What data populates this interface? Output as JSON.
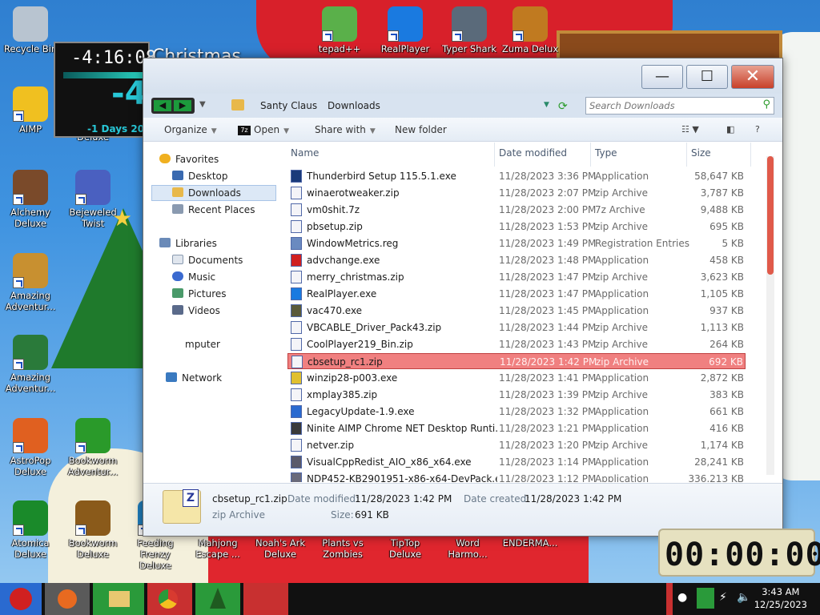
{
  "desktop": {
    "icons": [
      {
        "label": "Recycle Bin",
        "color": "#b8c4d0"
      },
      {
        "label": "AIMP",
        "color": "#f0c020"
      },
      {
        "label": "Alchemy Deluxe",
        "color": "#7a4a2a"
      },
      {
        "label": "Amazing Adventur...",
        "color": "#c89030"
      },
      {
        "label": "Amazing Adventur...",
        "color": "#2a7a3a"
      },
      {
        "label": "AstroPop Deluxe",
        "color": "#e06020"
      },
      {
        "label": "Atomica Deluxe",
        "color": "#1a8a2a"
      },
      {
        "label": "Bejeweled Twist",
        "color": "#4a60c0"
      },
      {
        "label": "Bookworm Adventur...",
        "color": "#2a9a2a"
      },
      {
        "label": "Bookworm Deluxe",
        "color": "#8a5a1a"
      },
      {
        "label": "Feeding Frenzy Deluxe",
        "color": "#2080c0"
      },
      {
        "label": "Mahjong Escape ...",
        "color": "#a04020"
      },
      {
        "label": "Noah's Ark Deluxe",
        "color": "#c08020"
      },
      {
        "label": "Plants vs Zombies",
        "color": "#4aa02a"
      },
      {
        "label": "TipTop Deluxe",
        "color": "#d04040"
      },
      {
        "label": "Word Harmo...",
        "color": "#6a4ab0"
      },
      {
        "label": "ENDERMA...",
        "color": "#303030"
      },
      {
        "label": "tepad++",
        "color": "#5ab04a"
      },
      {
        "label": "RealPlayer",
        "color": "#1a7ae0"
      },
      {
        "label": "Typer Shark",
        "color": "#5a6a7a"
      },
      {
        "label": "Zuma Delux",
        "color": "#c07a20"
      },
      {
        "label": "Deluxe",
        "color": "#000000"
      }
    ],
    "clock_widget": {
      "time": "-4:16:08",
      "big": "-4",
      "days": "-1 Days 20"
    },
    "xmas_title": "Christmas",
    "timer": "00:00:00"
  },
  "window": {
    "controls": {
      "minimize": "—",
      "maximize": "☐",
      "close": "✕"
    },
    "breadcrumb": [
      "Santy Claus",
      "Downloads"
    ],
    "search_placeholder": "Search Downloads",
    "toolbar": {
      "organize": "Organize",
      "open": "Open",
      "share": "Share with",
      "new_folder": "New folder"
    },
    "nav": {
      "favorites": "Favorites",
      "desktop": "Desktop",
      "downloads": "Downloads",
      "recent": "Recent Places",
      "libraries": "Libraries",
      "documents": "Documents",
      "music": "Music",
      "pictures": "Pictures",
      "videos": "Videos",
      "computer": "mputer",
      "network": "Network"
    },
    "columns": {
      "name": "Name",
      "date": "Date modified",
      "type": "Type",
      "size": "Size"
    },
    "files": [
      {
        "name": "Thunderbird Setup 115.5.1.exe",
        "date": "11/28/2023 3:36 PM",
        "type": "Application",
        "size": "58,647 KB",
        "icon": "#1a3a7a"
      },
      {
        "name": "winaerotweaker.zip",
        "date": "11/28/2023 2:07 PM",
        "type": "zip Archive",
        "size": "3,787 KB",
        "icon": "#f4f4f8"
      },
      {
        "name": "vm0shit.7z",
        "date": "11/28/2023 2:00 PM",
        "type": "7z Archive",
        "size": "9,488 KB",
        "icon": "#f4f4f8"
      },
      {
        "name": "pbsetup.zip",
        "date": "11/28/2023 1:53 PM",
        "type": "zip Archive",
        "size": "695 KB",
        "icon": "#f4f4f8"
      },
      {
        "name": "WindowMetrics.reg",
        "date": "11/28/2023 1:49 PM",
        "type": "Registration Entries",
        "size": "5 KB",
        "icon": "#6a8ac0"
      },
      {
        "name": "advchange.exe",
        "date": "11/28/2023 1:48 PM",
        "type": "Application",
        "size": "458 KB",
        "icon": "#d02020"
      },
      {
        "name": "merry_christmas.zip",
        "date": "11/28/2023 1:47 PM",
        "type": "zip Archive",
        "size": "3,623 KB",
        "icon": "#f4f4f8"
      },
      {
        "name": "RealPlayer.exe",
        "date": "11/28/2023 1:47 PM",
        "type": "Application",
        "size": "1,105 KB",
        "icon": "#1a7ae0"
      },
      {
        "name": "vac470.exe",
        "date": "11/28/2023 1:45 PM",
        "type": "Application",
        "size": "937 KB",
        "icon": "#5a5a3a"
      },
      {
        "name": "VBCABLE_Driver_Pack43.zip",
        "date": "11/28/2023 1:44 PM",
        "type": "zip Archive",
        "size": "1,113 KB",
        "icon": "#f4f4f8"
      },
      {
        "name": "CoolPlayer219_Bin.zip",
        "date": "11/28/2023 1:43 PM",
        "type": "zip Archive",
        "size": "264 KB",
        "icon": "#f4f4f8"
      },
      {
        "name": "cbsetup_rc1.zip",
        "date": "11/28/2023 1:42 PM",
        "type": "zip Archive",
        "size": "692 KB",
        "icon": "#f4f4f8",
        "selected": true
      },
      {
        "name": "winzip28-p003.exe",
        "date": "11/28/2023 1:41 PM",
        "type": "Application",
        "size": "2,872 KB",
        "icon": "#e0c030"
      },
      {
        "name": "xmplay385.zip",
        "date": "11/28/2023 1:39 PM",
        "type": "zip Archive",
        "size": "383 KB",
        "icon": "#f4f4f8"
      },
      {
        "name": "LegacyUpdate-1.9.exe",
        "date": "11/28/2023 1:32 PM",
        "type": "Application",
        "size": "661 KB",
        "icon": "#2a6ad0"
      },
      {
        "name": "Ninite AIMP Chrome NET Desktop Runti...",
        "date": "11/28/2023 1:21 PM",
        "type": "Application",
        "size": "416 KB",
        "icon": "#3a3a3a"
      },
      {
        "name": "netver.zip",
        "date": "11/28/2023 1:20 PM",
        "type": "zip Archive",
        "size": "1,174 KB",
        "icon": "#f4f4f8"
      },
      {
        "name": "VisualCppRedist_AIO_x86_x64.exe",
        "date": "11/28/2023 1:14 PM",
        "type": "Application",
        "size": "28,241 KB",
        "icon": "#5a5a6a"
      },
      {
        "name": "NDP452-KB2901951-x86-x64-DevPack.exe",
        "date": "11/28/2023 1:12 PM",
        "type": "Application",
        "size": "336,213 KB",
        "icon": "#6a6a7a"
      }
    ],
    "details": {
      "name": "cbsetup_rc1.zip",
      "type": "zip Archive",
      "modified_label": "Date modified:",
      "modified": "11/28/2023 1:42 PM",
      "created_label": "Date created:",
      "created": "11/28/2023 1:42 PM",
      "size_label": "Size:",
      "size": "691 KB"
    }
  },
  "taskbar": {
    "time": "3:43 AM",
    "date": "12/25/2023"
  }
}
